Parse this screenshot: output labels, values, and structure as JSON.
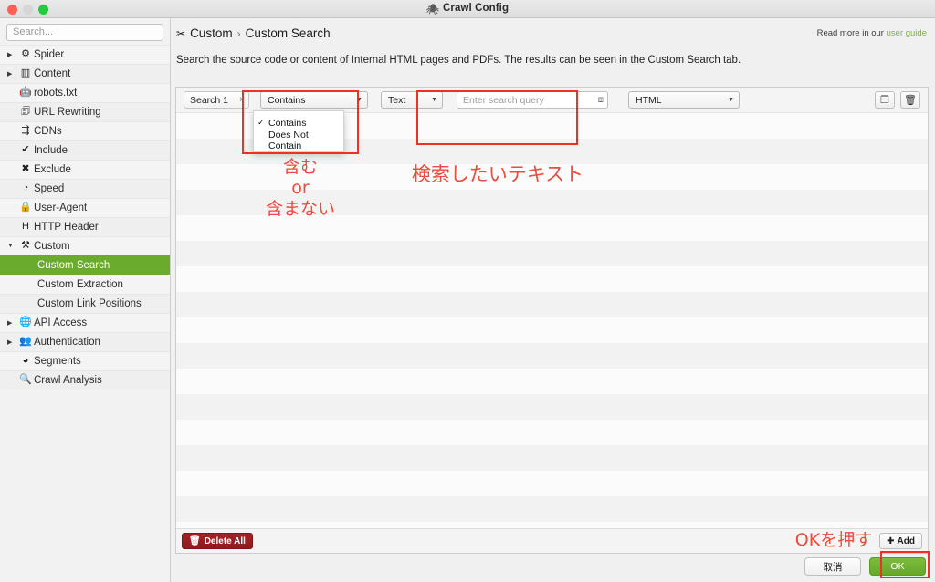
{
  "window": {
    "title": "Crawl Config",
    "title_icon": "spider-icon",
    "traffic_lights": [
      "close",
      "minimize",
      "zoom"
    ]
  },
  "sidebar": {
    "search": {
      "placeholder": "Search...",
      "value": ""
    },
    "items": [
      {
        "label": "Spider",
        "icon": "gear-icon",
        "arrow": "▶",
        "child": false,
        "selected": false
      },
      {
        "label": "Content",
        "icon": "columns-icon",
        "arrow": "▶",
        "child": false,
        "selected": false
      },
      {
        "label": "robots.txt",
        "icon": "robot-icon",
        "arrow": "",
        "child": false,
        "selected": false
      },
      {
        "label": "URL Rewriting",
        "icon": "edit-square-icon",
        "arrow": "",
        "child": false,
        "selected": false
      },
      {
        "label": "CDNs",
        "icon": "sitemap-icon",
        "arrow": "",
        "child": false,
        "selected": false
      },
      {
        "label": "Include",
        "icon": "check-circle-icon",
        "arrow": "",
        "child": false,
        "selected": false
      },
      {
        "label": "Exclude",
        "icon": "x-circle-icon",
        "arrow": "",
        "child": false,
        "selected": false
      },
      {
        "label": "Speed",
        "icon": "gauge-icon",
        "arrow": "",
        "child": false,
        "selected": false
      },
      {
        "label": "User-Agent",
        "icon": "user-agent-icon",
        "arrow": "",
        "child": false,
        "selected": false
      },
      {
        "label": "HTTP Header",
        "icon": "header-h-icon",
        "arrow": "",
        "child": false,
        "selected": false
      },
      {
        "label": "Custom",
        "icon": "wrench-icon",
        "arrow": "▼",
        "child": false,
        "selected": false
      },
      {
        "label": "Custom Search",
        "icon": "",
        "arrow": "",
        "child": true,
        "selected": true
      },
      {
        "label": "Custom Extraction",
        "icon": "",
        "arrow": "",
        "child": true,
        "selected": false
      },
      {
        "label": "Custom Link Positions",
        "icon": "",
        "arrow": "",
        "child": true,
        "selected": false
      },
      {
        "label": "API Access",
        "icon": "globe-icon",
        "arrow": "▶",
        "child": false,
        "selected": false
      },
      {
        "label": "Authentication",
        "icon": "users-lock-icon",
        "arrow": "▶",
        "child": false,
        "selected": false
      },
      {
        "label": "Segments",
        "icon": "pie-chart-icon",
        "arrow": "",
        "child": false,
        "selected": false
      },
      {
        "label": "Crawl Analysis",
        "icon": "magnifier-icon",
        "arrow": "",
        "child": false,
        "selected": false
      }
    ]
  },
  "header": {
    "breadcrumb_icon": "wrench-icon",
    "breadcrumb_parent": "Custom",
    "breadcrumb_sep": "›",
    "breadcrumb_current": "Custom Search",
    "read_more_prefix": "Read more in our ",
    "read_more_link": "user guide",
    "description": "Search the source code or content of Internal HTML pages and PDFs. The results can be seen in the Custom Search tab."
  },
  "search_row": {
    "name_label": "Search 1",
    "close_icon": "×",
    "match_select": {
      "value": "Contains",
      "options": [
        "Contains",
        "Does Not Contain"
      ],
      "selected_index": 0,
      "open": true
    },
    "type_select": {
      "value": "Text"
    },
    "query_input": {
      "value": "",
      "placeholder": "Enter search query",
      "expand_icon": "expand-icon"
    },
    "format_select": {
      "value": "HTML"
    },
    "copy_button_icon": "copy-icon",
    "delete_button_icon": "trash-icon"
  },
  "panel_footer": {
    "delete_all_label": "Delete All",
    "delete_all_icon": "trash-icon",
    "add_label": "Add",
    "add_icon": "plus-icon"
  },
  "dialog": {
    "cancel_label": "取消",
    "ok_label": "OK"
  },
  "annotations": {
    "contains_note": "含む\nor\n含まない",
    "query_note": "検索したいテキスト",
    "ok_note": "OKを押す",
    "color": "#ee4b3c"
  }
}
